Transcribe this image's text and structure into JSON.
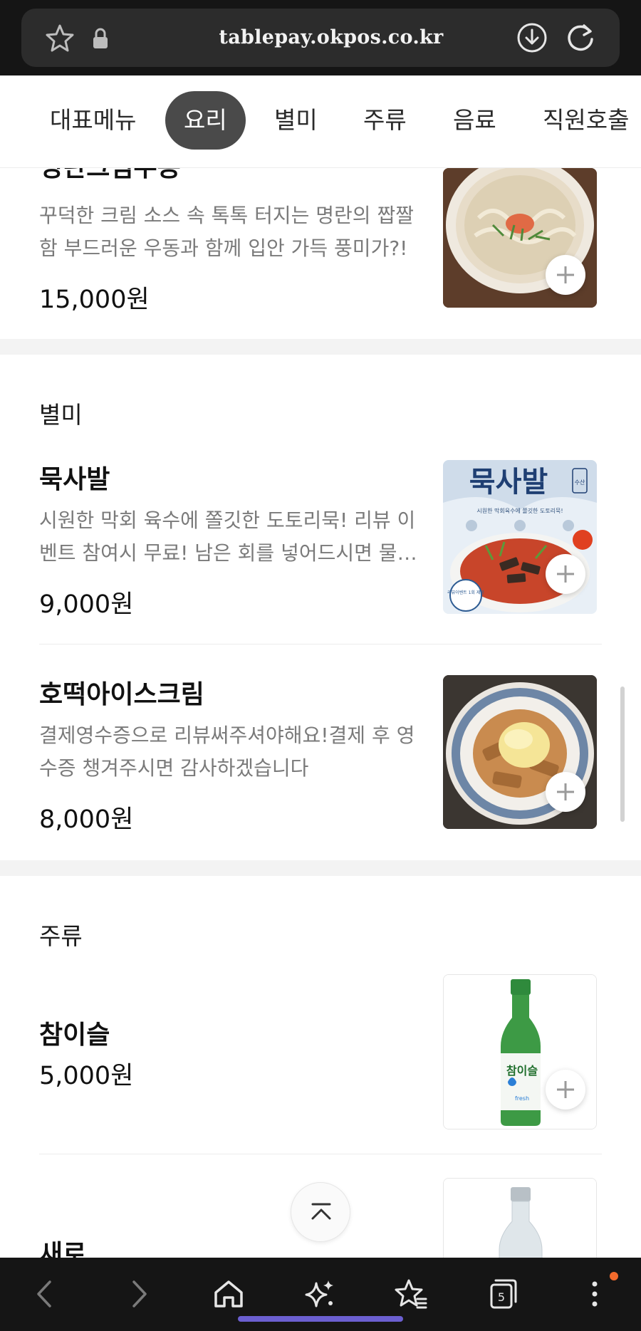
{
  "browser": {
    "url": "tablepay.okpos.co.kr",
    "tab_count": "5"
  },
  "tabs": [
    {
      "label": "대표메뉴",
      "active": false
    },
    {
      "label": "요리",
      "active": true
    },
    {
      "label": "별미",
      "active": false
    },
    {
      "label": "주류",
      "active": false
    },
    {
      "label": "음료",
      "active": false
    },
    {
      "label": "직원호출",
      "active": false
    }
  ],
  "partial_item": {
    "name": "명란크림우동",
    "desc_line1": "꾸덕한 크림 소스 속 톡톡 터지는 명란의 짭짤",
    "desc_line2": "함 부드러운 우동과 함께 입안 가득 풍미가?!",
    "price": "15,000원"
  },
  "sections": [
    {
      "title": "별미",
      "items": [
        {
          "name": "묵사발",
          "desc_line1": "시원한 막회 육수에 쫄깃한 도토리묵! 리뷰 이",
          "desc_line2": "벤트 참여시 무료! 남은 회를 넣어드시면 물회처럼 즐기실 수 있습니다",
          "price": "9,000원",
          "image_title": "묵사발",
          "image_sub": "시원한 막회육수에 쫄깃한 도토리묵!",
          "image_badge": "수산",
          "image_stamp": "리뷰이벤트 1회 제공"
        },
        {
          "name": "호떡아이스크림",
          "desc_line1": "결제영수증으로 리뷰써주셔야해요!결제 후 영",
          "desc_line2": "수증 챙겨주시면 감사하겠습니다",
          "price": "8,000원"
        }
      ]
    },
    {
      "title": "주류",
      "items": [
        {
          "name": "참이슬",
          "price": "5,000원",
          "label_text": "참이슬",
          "label_sub": "fresh"
        },
        {
          "name": "새로"
        }
      ]
    }
  ],
  "colors": {
    "active_tab": "#4a4a4a",
    "browser_bar": "#151515",
    "notification_dot": "#f26a2c",
    "home_indicator": "#6b5fd0"
  }
}
